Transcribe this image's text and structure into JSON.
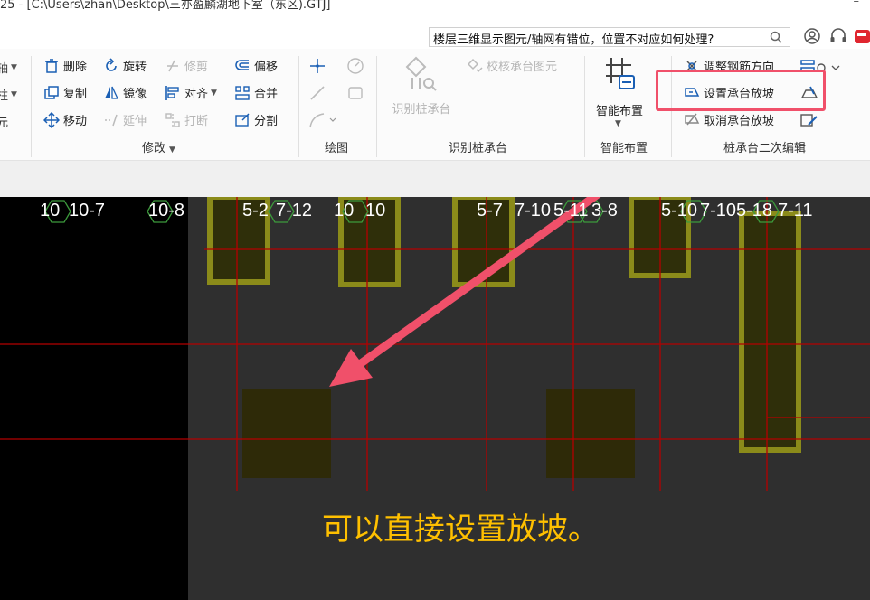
{
  "window": {
    "title": "25 - [C:\\Users\\zhan\\Desktop\\三亦盈麟湖地下室（东区).GTJ]",
    "minimize_glyph": "–"
  },
  "search": {
    "query": "楼层三维显示图元/轴网有错位，位置不对应如何处理?",
    "icon": "search-icon"
  },
  "ribbon": {
    "left_partial": [
      "轴",
      "柱",
      "元"
    ],
    "modify": {
      "delete": "删除",
      "rotate": "旋转",
      "trim": "修剪",
      "offset": "偏移",
      "copy": "复制",
      "mirror": "镜像",
      "align": "对齐",
      "merge": "合并",
      "move": "移动",
      "extend": "延伸",
      "break": "打断",
      "split": "分割",
      "group_label": "修改"
    },
    "draw": {
      "group_label": "绘图"
    },
    "identify": {
      "identify_pile_cap": "识别桩承台",
      "check_cap_elements": "校核承台图元",
      "group_label": "识别桩承台"
    },
    "smart": {
      "smart_layout": "智能布置",
      "group_label": "智能布置"
    },
    "secondary_edit": {
      "adjust_rebar_direction": "调整钢筋方向",
      "set_cap_slope": "设置承台放坡",
      "cancel_cap_slope": "取消承台放坡",
      "group_label": "桩承台二次编辑"
    }
  },
  "canvas": {
    "axis_labels": [
      "10",
      "10-7",
      "10-8",
      "5-2",
      "7-12",
      "10",
      "10",
      "5-7",
      "7-10",
      "5-11",
      "3-8",
      "5-10",
      "7-10",
      "5-18",
      "7-11"
    ],
    "caption": "可以直接设置放坡。"
  },
  "colors": {
    "accent_red": "#f0506a",
    "caption_yellow": "#ffc000",
    "cad_yellow": "#8b8b1a",
    "grid_red": "#b40000"
  }
}
